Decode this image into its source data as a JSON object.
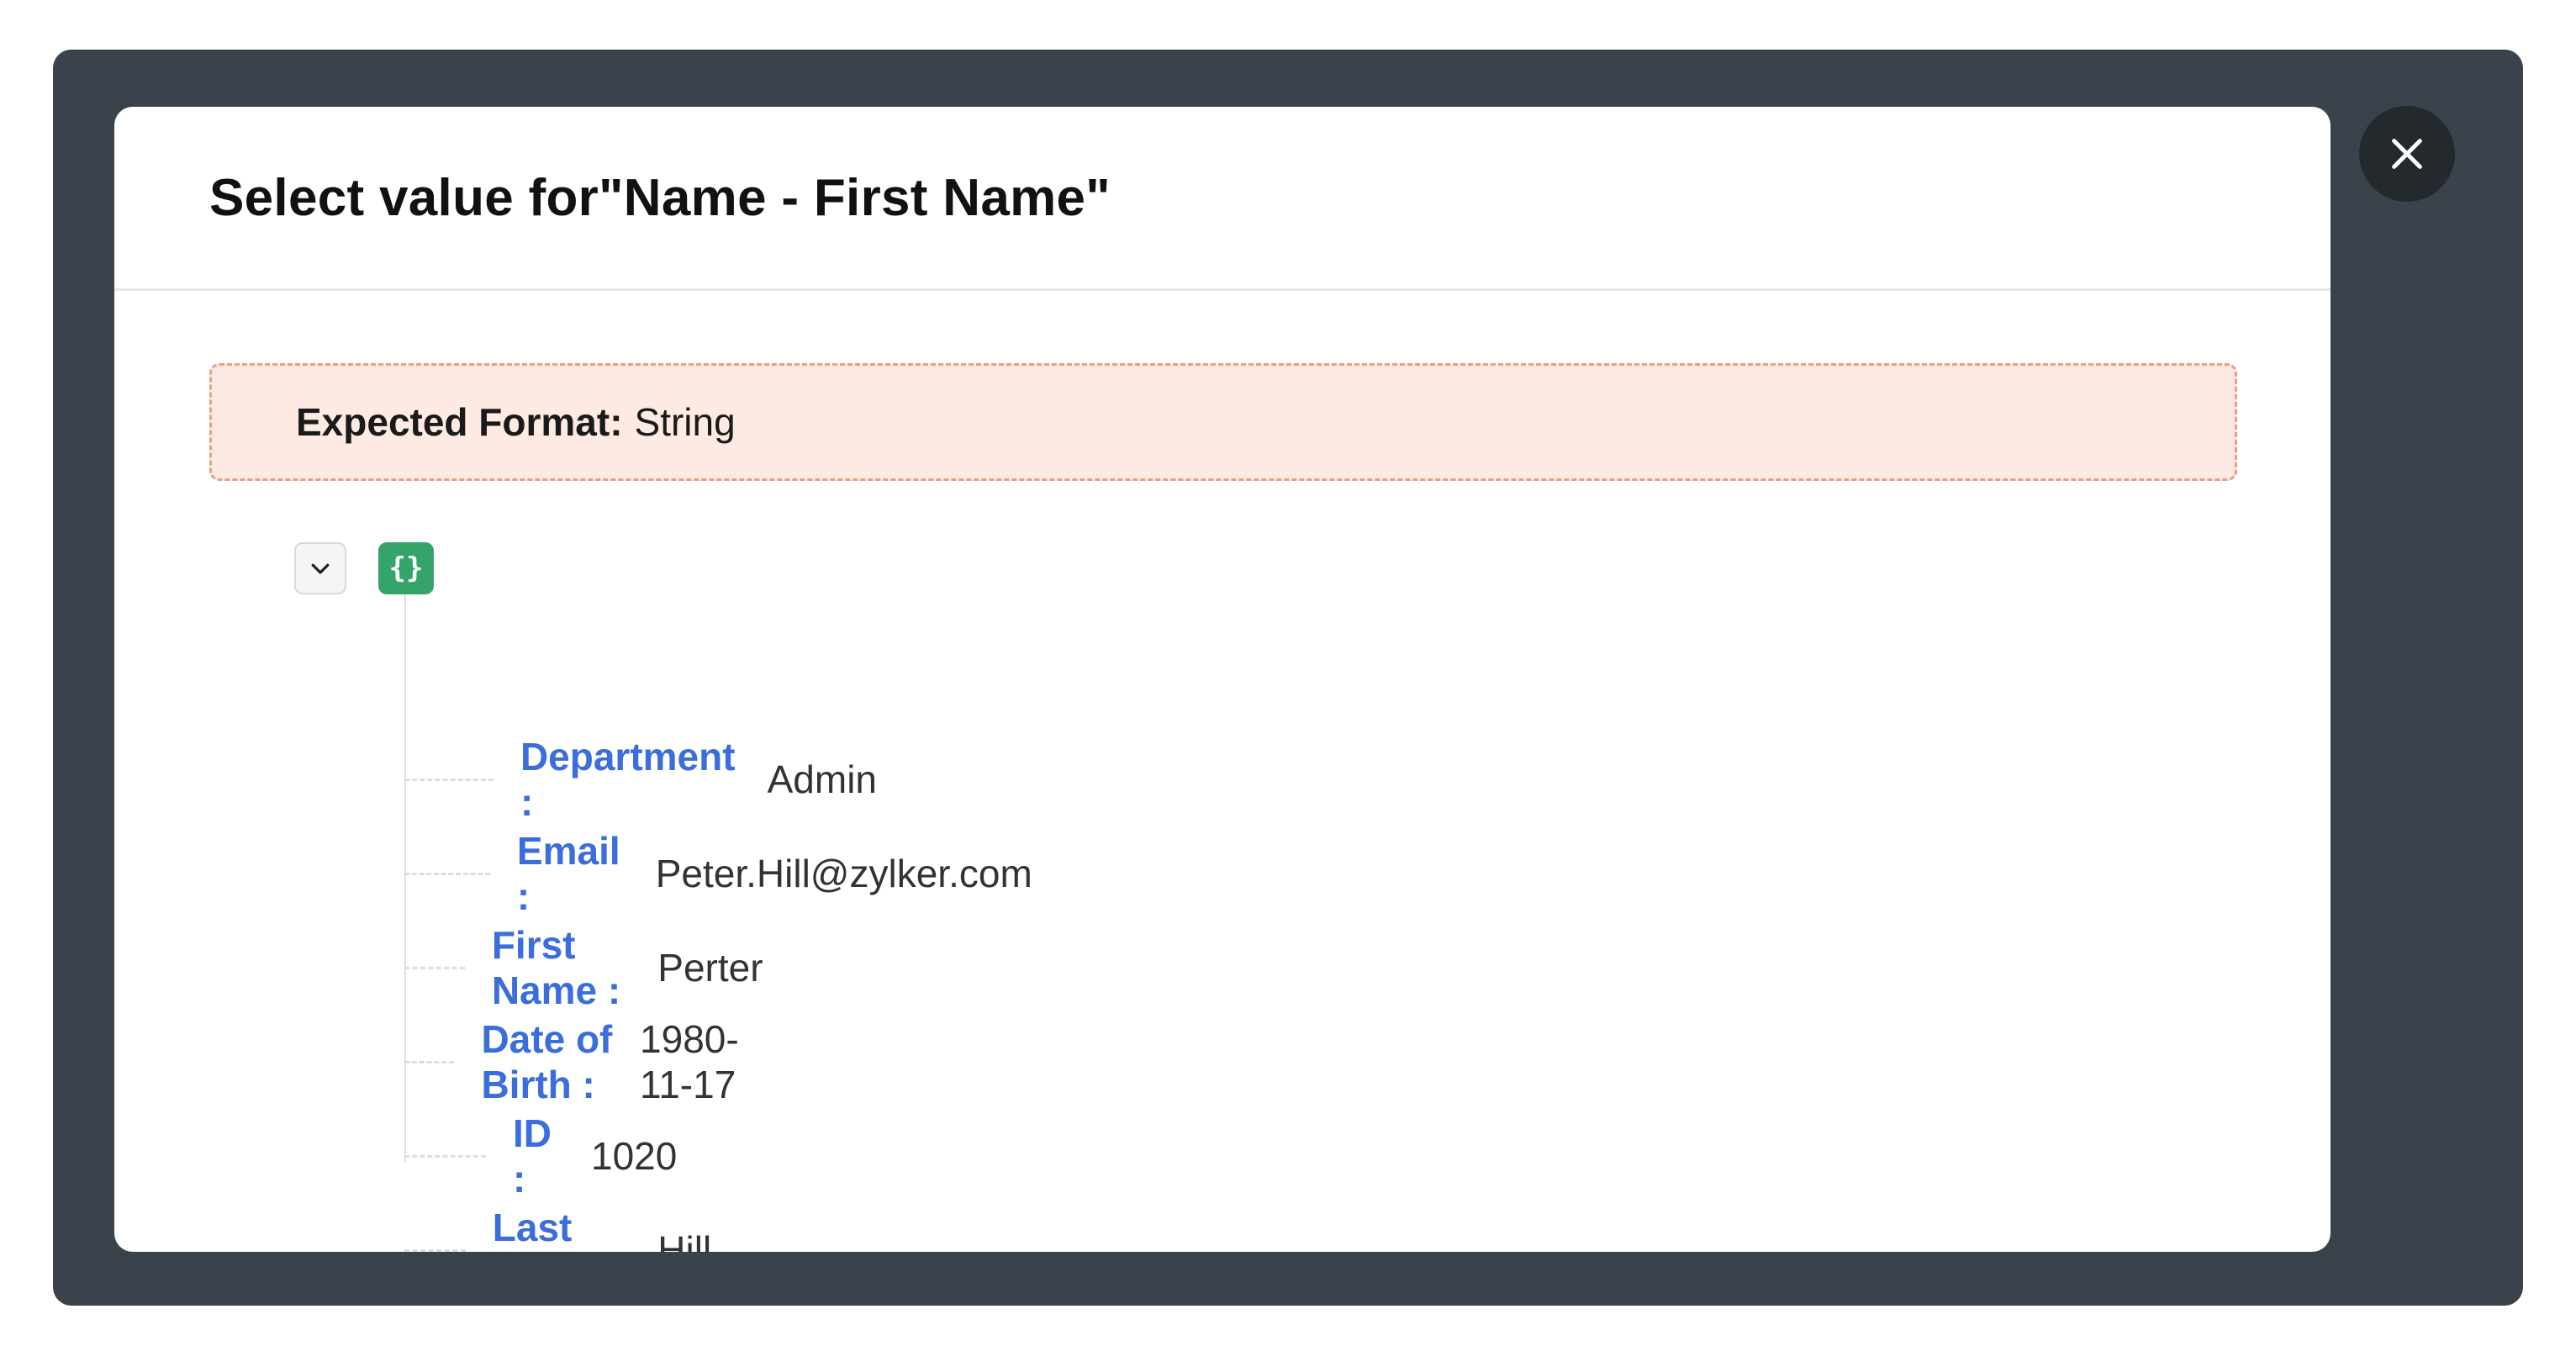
{
  "modal": {
    "title": "Select value for\"Name - First Name\""
  },
  "format": {
    "label": "Expected Format:",
    "value": "String"
  },
  "tree": {
    "badge": "{}",
    "items": [
      {
        "key": "Department :",
        "value": "Admin"
      },
      {
        "key": "Email :",
        "value": "Peter.Hill@zylker.com"
      },
      {
        "key": "First Name :",
        "value": "Perter"
      },
      {
        "key": "Date of Birth :",
        "value": "1980-11-17"
      },
      {
        "key": "ID :",
        "value": "1020"
      },
      {
        "key": "Last Name :",
        "value": "Hill"
      }
    ]
  },
  "icons": {
    "close": "close-icon",
    "toggle": "chevron-down-icon"
  },
  "colors": {
    "backdrop": "#3a434b",
    "key": "#3b6ddc",
    "badge": "#35a46b",
    "format_bg": "#fdebe3",
    "format_border": "#ec9c85"
  }
}
